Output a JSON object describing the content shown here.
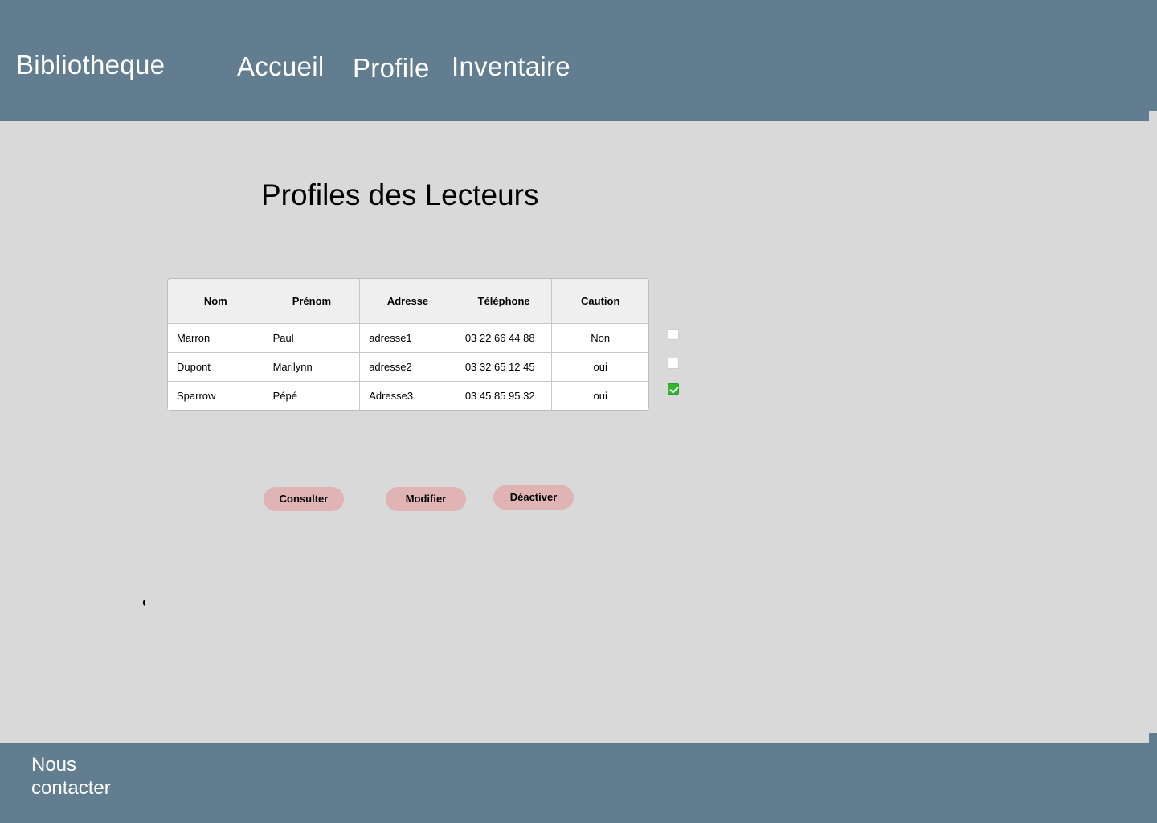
{
  "header": {
    "brand": "Bibliotheque",
    "nav": {
      "accueil": "Accueil",
      "profile": "Profile",
      "inventaire": "Inventaire"
    }
  },
  "main": {
    "title": "Profiles des Lecteurs",
    "table": {
      "columns": [
        "Nom",
        "Prénom",
        "Adresse",
        "Téléphone",
        "Caution"
      ],
      "rows": [
        {
          "nom": "Marron",
          "prenom": "Paul",
          "adresse": "adresse1",
          "telephone": "03 22 66 44 88",
          "caution": "Non",
          "selected": false
        },
        {
          "nom": "Dupont",
          "prenom": "Marilynn",
          "adresse": "adresse2",
          "telephone": "03 32 65 12 45",
          "caution": "oui",
          "selected": false
        },
        {
          "nom": "Sparrow",
          "prenom": "Pépé",
          "adresse": "Adresse3",
          "telephone": "03 45 85 95 32",
          "caution": "oui",
          "selected": true
        }
      ]
    },
    "actions": {
      "consulter": "Consulter",
      "modifier": "Modifier",
      "desactiver": "Déactiver"
    }
  },
  "footer": {
    "contact": "Nous contacter"
  },
  "colors": {
    "header_bg": "#617d8f",
    "page_bg": "#d9d9d9",
    "button_bg": "#e0b4b4",
    "checkbox_checked": "#2fb82f"
  }
}
